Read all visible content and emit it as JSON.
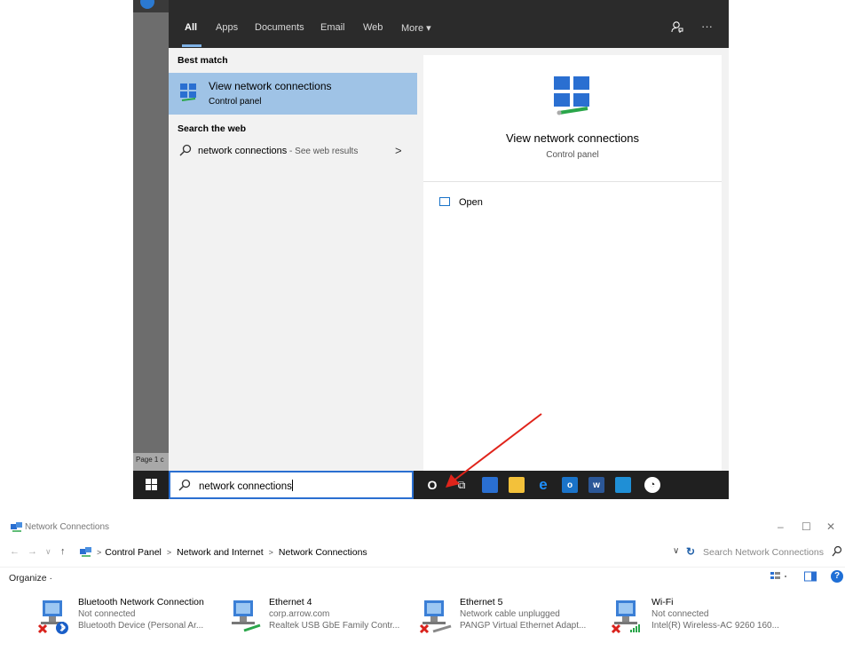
{
  "start_search": {
    "tabs": [
      {
        "label": "All",
        "active": true
      },
      {
        "label": "Apps"
      },
      {
        "label": "Documents"
      },
      {
        "label": "Email"
      },
      {
        "label": "Web"
      },
      {
        "label": "More ▾"
      }
    ],
    "more_icons": {
      "feedback": "feedback-icon",
      "options": "···"
    },
    "best_match_header": "Best match",
    "best_match": {
      "title": "View network connections",
      "subtitle": "Control panel"
    },
    "search_web_header": "Search the web",
    "web_result": {
      "query": "network connections",
      "suffix": " - See web results",
      "chevron": ">"
    },
    "preview": {
      "title": "View network connections",
      "subtitle": "Control panel",
      "open_label": "Open"
    },
    "search_box_text": "network connections",
    "word_page_label": "Page 1 c"
  },
  "network_window": {
    "title": "Network Connections",
    "breadcrumbs": [
      "Control Panel",
      "Network and Internet",
      "Network Connections"
    ],
    "search_placeholder": "Search Network Connections",
    "organize_label": "Organize ·",
    "connections": [
      {
        "name": "Bluetooth Network Connection",
        "status": "Not connected",
        "device": "Bluetooth Device (Personal Ar...",
        "icon": "bluetooth-adapter-icon"
      },
      {
        "name": "Ethernet 4",
        "status": "corp.arrow.com",
        "device": "Realtek USB GbE Family Contr...",
        "icon": "ethernet-adapter-icon"
      },
      {
        "name": "Ethernet 5",
        "status": "Network cable unplugged",
        "device": "PANGP Virtual Ethernet Adapt...",
        "icon": "ethernet-disconnected-icon"
      },
      {
        "name": "Wi-Fi",
        "status": "Not connected",
        "device": "Intel(R) Wireless-AC 9260 160...",
        "icon": "wifi-adapter-icon"
      }
    ]
  },
  "colors": {
    "selection": "#9fc3e6",
    "accent": "#2a6fd1",
    "arrow": "#e0241b",
    "taskbar": "#202020"
  }
}
